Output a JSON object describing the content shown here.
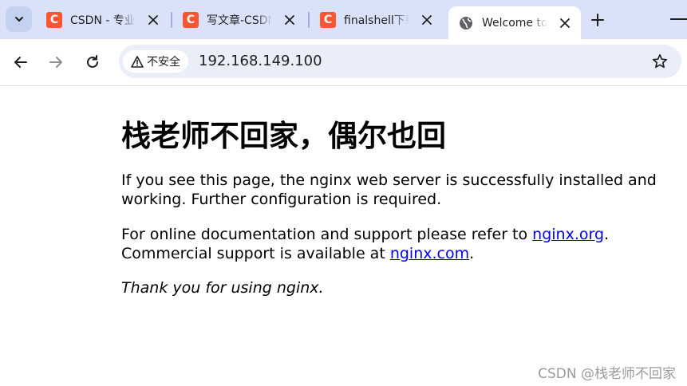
{
  "browser": {
    "tabs": [
      {
        "title": "CSDN - 专业",
        "favicon": "csdn-icon",
        "active": false
      },
      {
        "title": "写文章-CSDN",
        "favicon": "csdn-icon",
        "active": false
      },
      {
        "title": "finalshell下载",
        "favicon": "csdn-icon",
        "active": false
      },
      {
        "title": "Welcome to",
        "favicon": "globe-icon",
        "active": true
      }
    ],
    "favicon_letter": "C",
    "security_chip": "不安全",
    "url": "192.168.149.100"
  },
  "page": {
    "heading": "栈老师不回家，偶尔也回",
    "p1": "If you see this page, the nginx web server is successfully installed and working. Further configuration is required.",
    "p2_before": "For online documentation and support please refer to ",
    "p2_link1": "nginx.org",
    "p2_mid": ". Commercial support is available at ",
    "p2_link2": "nginx.com",
    "p2_after": ".",
    "p3": "Thank you for using nginx."
  },
  "watermark": "CSDN @栈老师不回家",
  "colors": {
    "accent_csdn": "#fc5531",
    "link": "#0000ee",
    "tabstrip": "#dae2f9"
  }
}
